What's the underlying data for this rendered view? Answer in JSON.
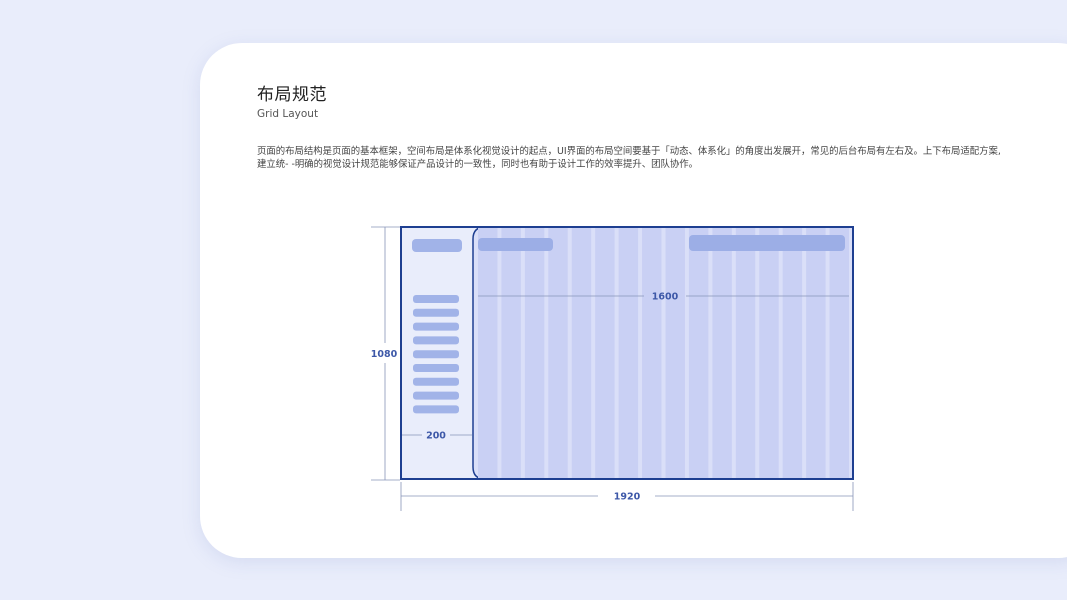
{
  "page": {
    "title": "布局规范",
    "subtitle": "Grid Layout",
    "description": "页面的布局结构是页面的基本框架，空间布局是体系化视觉设计的起点，UI界面的布局空间要基于「动态、体系化」的角度出发展开，常见的后台布局有左右及。上下布局适配方案,建立统- -明确的视觉设计规范能够保证产品设计的一致性，同时也有助于设计工作的效率提升、团队协作。"
  },
  "diagram": {
    "total_width_label": "1920",
    "total_height_label": "1080",
    "sidebar_width_label": "200",
    "content_width_label": "1600",
    "sidebar_menu_item_count": 9,
    "grid_column_count": 16,
    "colors": {
      "frame": "#1e3f91",
      "sidebar_bg": "#e9edfb",
      "content_bg": "#dadff8",
      "column": "#c9d0f4",
      "bar": "#a1b3e8",
      "header_bar": "#9caee6",
      "dim_line": "#8795b8",
      "dim_text": "#3d58a8"
    }
  }
}
